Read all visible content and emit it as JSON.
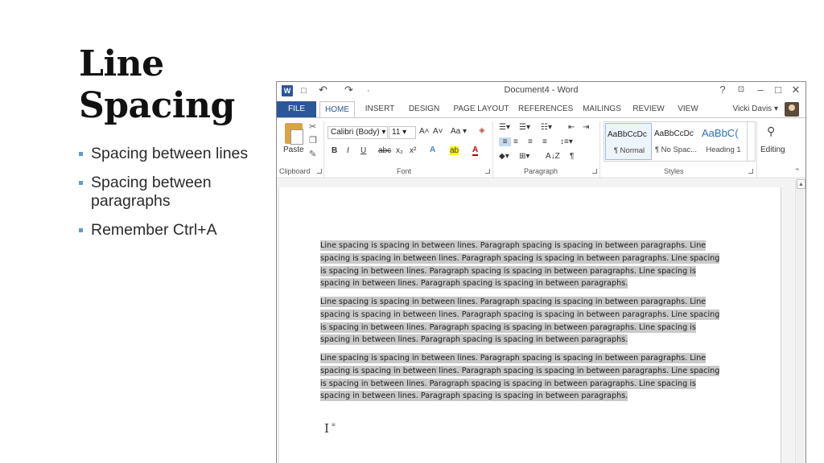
{
  "slide": {
    "title_line1": "Line",
    "title_line2": "Spacing",
    "bullets": [
      "Spacing between lines",
      "Spacing between paragraphs",
      "Remember Ctrl+A"
    ],
    "accent_color": "#5b9bd5"
  },
  "window": {
    "title": "Document4 - Word",
    "user": "Vicki Davis",
    "app_icon": "word-logo",
    "app_icon_letter": "W",
    "controls": {
      "help": "?",
      "minimize": "–",
      "restore": "□",
      "close": "✕"
    },
    "qat": {
      "save": "□",
      "undo": "↶",
      "redo": "↷",
      "customize": "·"
    }
  },
  "ribbon": {
    "tabs": [
      "FILE",
      "HOME",
      "INSERT",
      "DESIGN",
      "PAGE LAYOUT",
      "REFERENCES",
      "MAILINGS",
      "REVIEW",
      "VIEW"
    ],
    "active_tab": "HOME",
    "groups": [
      "Clipboard",
      "Font",
      "Paragraph",
      "Styles"
    ],
    "clipboard": {
      "paste": "Paste"
    },
    "font": {
      "name": "Calibri (Body)",
      "size": "11",
      "grow": "A˄",
      "shrink": "A˅",
      "case": "Aa",
      "bold": "B",
      "italic": "I",
      "underline": "U",
      "strikethrough": "abc",
      "subscript": "x₂",
      "superscript": "x²",
      "effects": "A",
      "highlight": "ab",
      "color": "A"
    },
    "paragraph": {
      "sort": "A↓Z",
      "pilcrow": "¶"
    },
    "styles": [
      {
        "sample": "AaBbCcDc",
        "name": "¶ Normal"
      },
      {
        "sample": "AaBbCcDc",
        "name": "¶ No Spac..."
      },
      {
        "sample": "AaBbC(",
        "name": "Heading 1"
      }
    ],
    "editing": "Editing",
    "brand_color": "#2b579a",
    "heading_color": "#2e74b5"
  },
  "document": {
    "paragraphs": [
      "Line spacing is spacing in between lines. Paragraph spacing is spacing in between paragraphs. Line spacing is spacing in between lines. Paragraph spacing is spacing in between paragraphs. Line spacing is spacing in between lines. Paragraph spacing is spacing in between paragraphs. Line spacing is spacing in between lines. Paragraph spacing is spacing in between paragraphs.",
      "Line spacing is spacing in between lines. Paragraph spacing is spacing in between paragraphs. Line spacing is spacing in between lines. Paragraph spacing is spacing in between paragraphs. Line spacing is spacing in between lines. Paragraph spacing is spacing in between paragraphs. Line spacing is spacing in between lines. Paragraph spacing is spacing in between paragraphs.",
      "Line spacing is spacing in between lines. Paragraph spacing is spacing in between paragraphs. Line spacing is spacing in between lines. Paragraph spacing is spacing in between paragraphs. Line spacing is spacing in between lines. Paragraph spacing is spacing in between paragraphs. Line spacing is spacing in between lines. Paragraph spacing is spacing in between paragraphs."
    ],
    "selection_color": "#c9c9c9"
  }
}
